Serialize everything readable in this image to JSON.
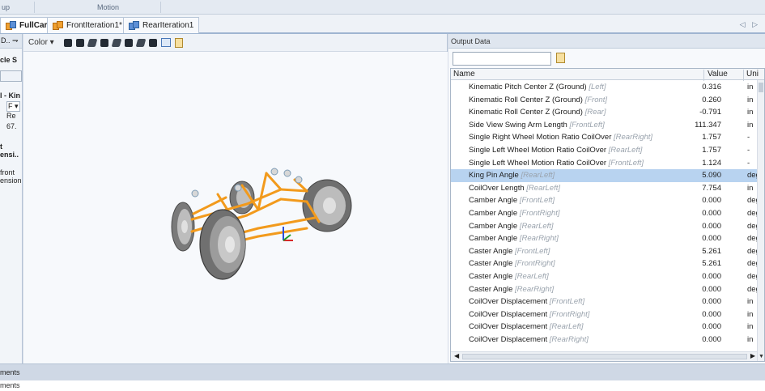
{
  "ribbon": {
    "left_group": "up",
    "motion_group": "Motion"
  },
  "tabs": [
    {
      "label": "FullCar",
      "active": true
    },
    {
      "label": "FrontIteration1*",
      "active": false
    },
    {
      "label": "RearIteration1",
      "active": false
    }
  ],
  "tab_nav": "◁ ▷",
  "left_panel": {
    "header": "D.. ⇁",
    "section": "cle S",
    "item_prefix": "l - Kin",
    "dropdown": "F ▾",
    "re_label": "Re",
    "value": "67.",
    "t_label": "t",
    "ensi_label": "ensi..",
    "front_label": "front",
    "ension_label": "ension"
  },
  "view_toolbar": {
    "color_label": "Color ▾"
  },
  "output": {
    "title": "Output Data",
    "columns": {
      "name": "Name",
      "value": "Value",
      "unit": "Uni"
    },
    "rows": [
      {
        "name": "Kinematic Pitch Center Z (Ground)",
        "qual": "[Left]",
        "value": "0.316",
        "unit": "in"
      },
      {
        "name": "Kinematic Roll Center Z (Ground)",
        "qual": "[Front]",
        "value": "0.260",
        "unit": "in"
      },
      {
        "name": "Kinematic Roll Center Z (Ground)",
        "qual": "[Rear]",
        "value": "-0.791",
        "unit": "in"
      },
      {
        "name": "Side View Swing Arm Length",
        "qual": "[FrontLeft]",
        "value": "111.347",
        "unit": "in"
      },
      {
        "name": "Single Right Wheel Motion Ratio CoilOver",
        "qual": "[RearRight]",
        "value": "1.757",
        "unit": "-"
      },
      {
        "name": "Single Left Wheel Motion Ratio CoilOver",
        "qual": "[RearLeft]",
        "value": "1.757",
        "unit": "-"
      },
      {
        "name": "Single Left Wheel Motion Ratio CoilOver",
        "qual": "[FrontLeft]",
        "value": "1.124",
        "unit": "-"
      },
      {
        "name": "King Pin Angle",
        "qual": "[RearLeft]",
        "value": "5.090",
        "unit": "deg"
      },
      {
        "name": "CoilOver Length",
        "qual": "[RearLeft]",
        "value": "7.754",
        "unit": "in"
      },
      {
        "name": "Camber Angle",
        "qual": "[FrontLeft]",
        "value": "0.000",
        "unit": "deg"
      },
      {
        "name": "Camber Angle",
        "qual": "[FrontRight]",
        "value": "0.000",
        "unit": "deg"
      },
      {
        "name": "Camber Angle",
        "qual": "[RearLeft]",
        "value": "0.000",
        "unit": "deg"
      },
      {
        "name": "Camber Angle",
        "qual": "[RearRight]",
        "value": "0.000",
        "unit": "deg"
      },
      {
        "name": "Caster Angle",
        "qual": "[FrontLeft]",
        "value": "5.261",
        "unit": "deg"
      },
      {
        "name": "Caster Angle",
        "qual": "[FrontRight]",
        "value": "5.261",
        "unit": "deg"
      },
      {
        "name": "Caster Angle",
        "qual": "[RearLeft]",
        "value": "0.000",
        "unit": "deg"
      },
      {
        "name": "Caster Angle",
        "qual": "[RearRight]",
        "value": "0.000",
        "unit": "deg"
      },
      {
        "name": "CoilOver Displacement",
        "qual": "[FrontLeft]",
        "value": "0.000",
        "unit": "in"
      },
      {
        "name": "CoilOver Displacement",
        "qual": "[FrontRight]",
        "value": "0.000",
        "unit": "in"
      },
      {
        "name": "CoilOver Displacement",
        "qual": "[RearLeft]",
        "value": "0.000",
        "unit": "in"
      },
      {
        "name": "CoilOver Displacement",
        "qual": "[RearRight]",
        "value": "0.000",
        "unit": "in"
      }
    ],
    "selected_index": 7
  },
  "comments": {
    "bar_label": "ments",
    "text_label": "ments"
  },
  "colors": {
    "accent": "#b8d3f0",
    "tab_border": "#9fb5d1",
    "suspension_orange": "#f29a1c",
    "tire_gray": "#8c8c8c"
  }
}
